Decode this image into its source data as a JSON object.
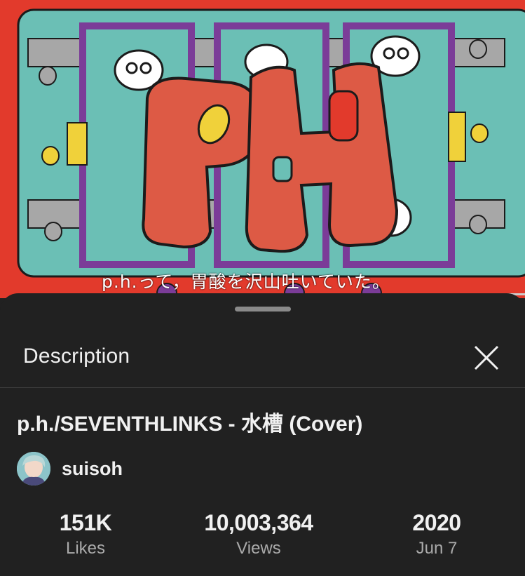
{
  "video": {
    "thumbnail_logo_text": "PH",
    "thumbnail_caption": "p.h.って，胃酸を沢山吐いていた。"
  },
  "sheet": {
    "title": "Description",
    "close_icon": "close-icon"
  },
  "video_info": {
    "title": "p.h./SEVENTHLINKS - 水槽 (Cover)",
    "channel_name": "suisoh"
  },
  "stats": {
    "likes_value": "151K",
    "likes_label": "Likes",
    "views_value": "10,003,364",
    "views_label": "Views",
    "year_value": "2020",
    "date_label": "Jun 7"
  },
  "colors": {
    "background": "#212121",
    "text_primary": "#f1f1f1",
    "text_secondary": "#aaaaaa",
    "thumbnail_red": "#e23a2c",
    "thumbnail_teal": "#6bbfb5"
  }
}
